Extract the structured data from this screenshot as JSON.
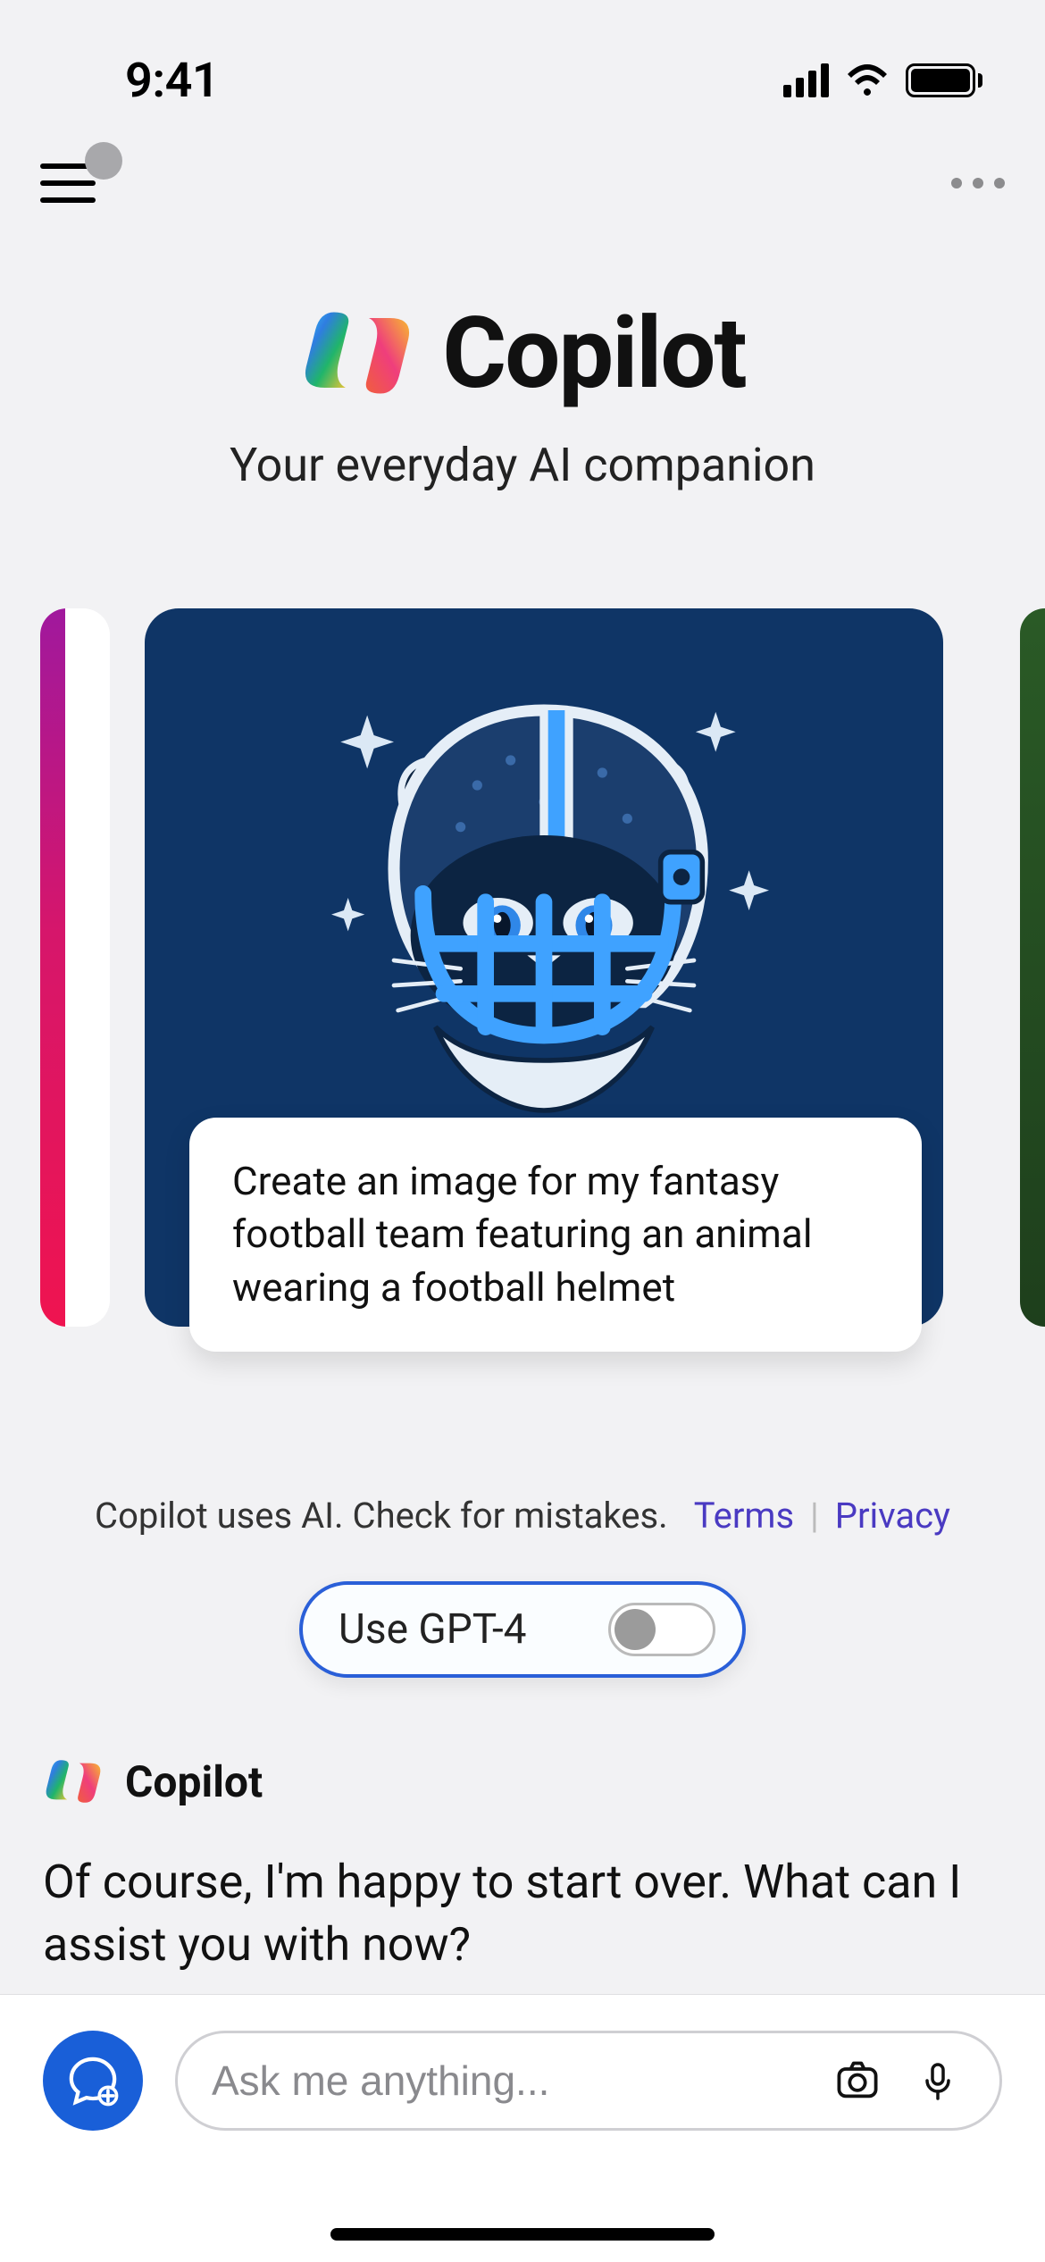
{
  "status": {
    "time": "9:41"
  },
  "hero": {
    "name": "Copilot",
    "subtitle": "Your everyday AI companion"
  },
  "card": {
    "caption": "Create an image for my fantasy football team featuring an animal wearing a football helmet"
  },
  "disclaimer": {
    "text": "Copilot uses AI. Check for mistakes.",
    "terms": "Terms",
    "privacy": "Privacy"
  },
  "toggle": {
    "label": "Use GPT-4",
    "on": false
  },
  "chat": {
    "sender": "Copilot",
    "message": "Of course, I'm happy to start over. What can I assist you with now?"
  },
  "input": {
    "placeholder": "Ask me anything..."
  }
}
